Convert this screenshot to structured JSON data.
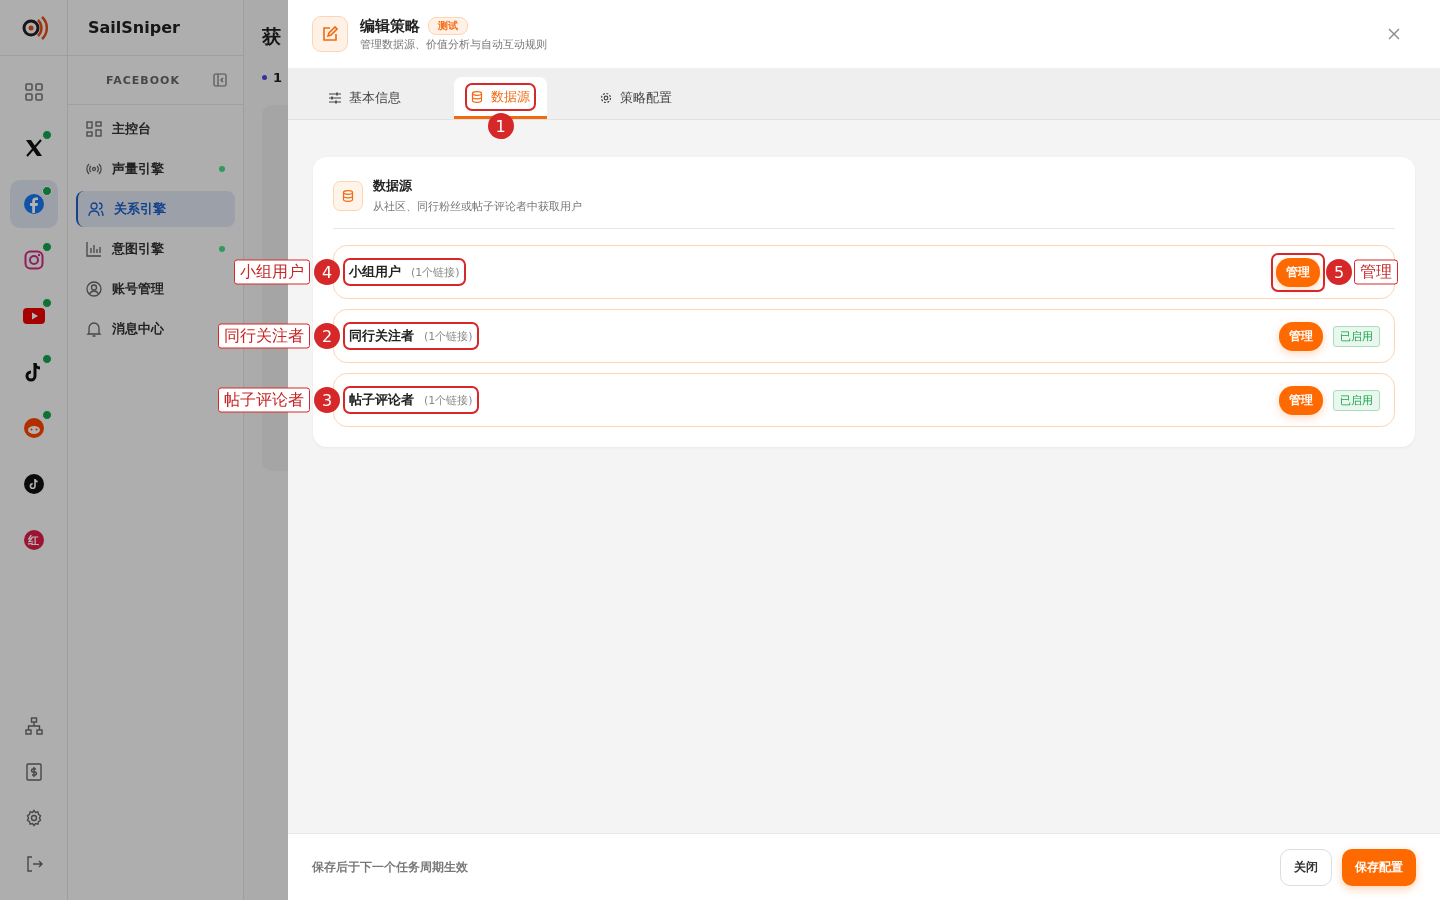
{
  "app": {
    "name": "SailSniper"
  },
  "platforms": [
    {
      "kind": "grid",
      "online": false,
      "selected": false
    },
    {
      "kind": "x",
      "online": true,
      "selected": false
    },
    {
      "kind": "facebook",
      "online": true,
      "selected": true
    },
    {
      "kind": "instagram",
      "online": true,
      "selected": false
    },
    {
      "kind": "youtube",
      "online": true,
      "selected": false
    },
    {
      "kind": "tiktok",
      "online": true,
      "selected": false
    },
    {
      "kind": "reddit",
      "online": true,
      "selected": false
    },
    {
      "kind": "tiktok-round",
      "online": false,
      "selected": false
    },
    {
      "kind": "red",
      "online": false,
      "selected": false,
      "glyph": "红"
    }
  ],
  "rail_tools": [
    {
      "kind": "org"
    },
    {
      "kind": "bill"
    },
    {
      "kind": "settings"
    },
    {
      "kind": "logout"
    }
  ],
  "nav": {
    "section": "FACEBOOK",
    "items": [
      {
        "kind": "dashboard",
        "label": "主控台",
        "indicator": false,
        "selected": false
      },
      {
        "kind": "radio",
        "label": "声量引擎",
        "indicator": true,
        "selected": false
      },
      {
        "kind": "users",
        "label": "关系引擎",
        "indicator": false,
        "selected": true
      },
      {
        "kind": "chart",
        "label": "意图引擎",
        "indicator": true,
        "selected": false
      },
      {
        "kind": "account",
        "label": "账号管理",
        "indicator": false,
        "selected": false
      },
      {
        "kind": "bell",
        "label": "消息中心",
        "indicator": false,
        "selected": false
      }
    ]
  },
  "background_page": {
    "title": "获",
    "step": "1"
  },
  "drawer": {
    "title": "编辑策略",
    "badge": "测试",
    "subtitle": "管理数据源、价值分析与自动互动规则",
    "tabs": [
      {
        "kind": "sliders",
        "label": "基本信息",
        "selected": false
      },
      {
        "kind": "database",
        "label": "数据源",
        "selected": true,
        "annotation": {
          "number": "1"
        }
      },
      {
        "kind": "gear",
        "label": "策略配置",
        "selected": false
      }
    ],
    "section": {
      "title": "数据源",
      "description": "从社区、同行粉丝或帖子评论者中获取用户"
    },
    "sources": [
      {
        "name": "小组用户",
        "count": "(1个链接)",
        "action": "管理",
        "annotation": {
          "number": "4",
          "label": "小组用户"
        },
        "action_annotation": {
          "number": "5",
          "label": "管理"
        }
      },
      {
        "name": "同行关注者",
        "count": "(1个链接)",
        "action": "管理",
        "status": "已启用",
        "annotation": {
          "number": "2",
          "label": "同行关注者"
        }
      },
      {
        "name": "帖子评论者",
        "count": "(1个链接)",
        "action": "管理",
        "status": "已启用",
        "annotation": {
          "number": "3",
          "label": "帖子评论者"
        }
      }
    ],
    "footer_note": "保存后于下一个任务周期生效",
    "buttons": [
      {
        "kind": "secondary",
        "label": "关闭"
      },
      {
        "kind": "primary",
        "label": "保存配置"
      }
    ]
  }
}
